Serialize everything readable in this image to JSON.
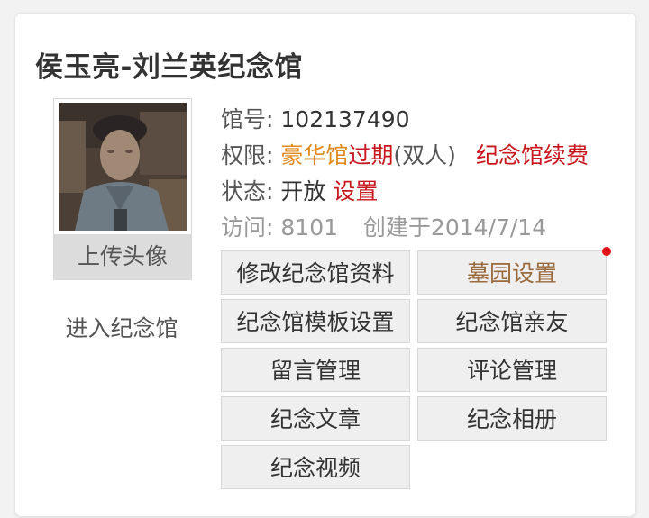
{
  "memorial": {
    "title": "侯玉亮-刘兰英纪念馆",
    "hall_label": "馆号:",
    "hall_number": "102137490",
    "permission_label": "权限:",
    "permission_type": "豪华馆",
    "permission_expired": "过期",
    "permission_suffix": "(双人)",
    "renew_link": "纪念馆续费",
    "status_label": "状态:",
    "status_value": "开放",
    "status_settings_link": "设置",
    "visits_label": "访问:",
    "visits_value": "8101",
    "created_text": "创建于2014/7/14"
  },
  "sidebar": {
    "upload_avatar": "上传头像",
    "enter_memorial": "进入纪念馆"
  },
  "actions": {
    "edit_info": "修改纪念馆资料",
    "cemetery_settings": "墓园设置",
    "template_settings": "纪念馆模板设置",
    "relatives": "纪念馆亲友",
    "message_mgmt": "留言管理",
    "comment_mgmt": "评论管理",
    "articles": "纪念文章",
    "albums": "纪念相册",
    "videos": "纪念视频"
  },
  "colors": {
    "accent_red": "#c8161d",
    "accent_orange": "#e08a1e",
    "gold_text": "#9b6a3c",
    "notification_dot": "#e5141a"
  }
}
